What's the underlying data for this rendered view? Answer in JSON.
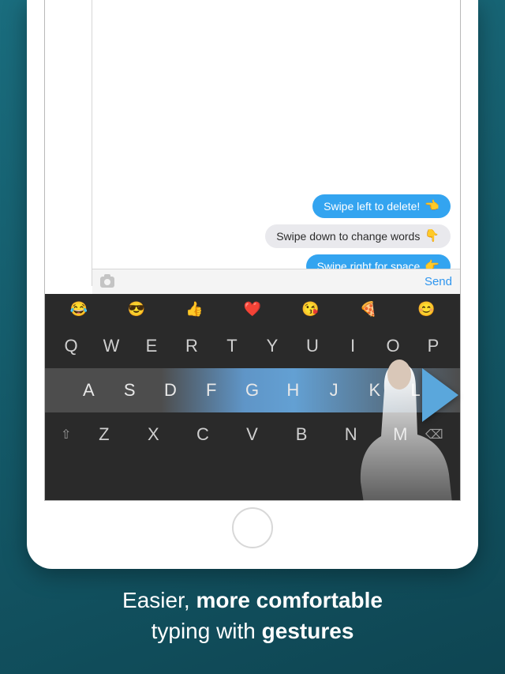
{
  "messages": [
    {
      "style": "blue",
      "text": "Swipe left to delete!",
      "emoji": "👈"
    },
    {
      "style": "gray",
      "text": "Swipe down to change words",
      "emoji": "👇"
    },
    {
      "style": "blue",
      "text": "Swipe right for space",
      "emoji": "👉"
    }
  ],
  "compose": {
    "send": "Send"
  },
  "emoji_row": [
    "😂",
    "😎",
    "👍",
    "❤️",
    "😘",
    "🍕",
    "😊"
  ],
  "rows": {
    "r1": [
      "Q",
      "W",
      "E",
      "R",
      "T",
      "Y",
      "U",
      "I",
      "O",
      "P"
    ],
    "r2": [
      "A",
      "S",
      "D",
      "F",
      "G",
      "H",
      "J",
      "K",
      "L"
    ],
    "r3": [
      "Z",
      "X",
      "C",
      "V",
      "B",
      "N",
      "M"
    ]
  },
  "caption": {
    "l1a": "Easier, ",
    "l1b": "more comfortable",
    "l2a": "typing with ",
    "l2b": "gestures"
  }
}
